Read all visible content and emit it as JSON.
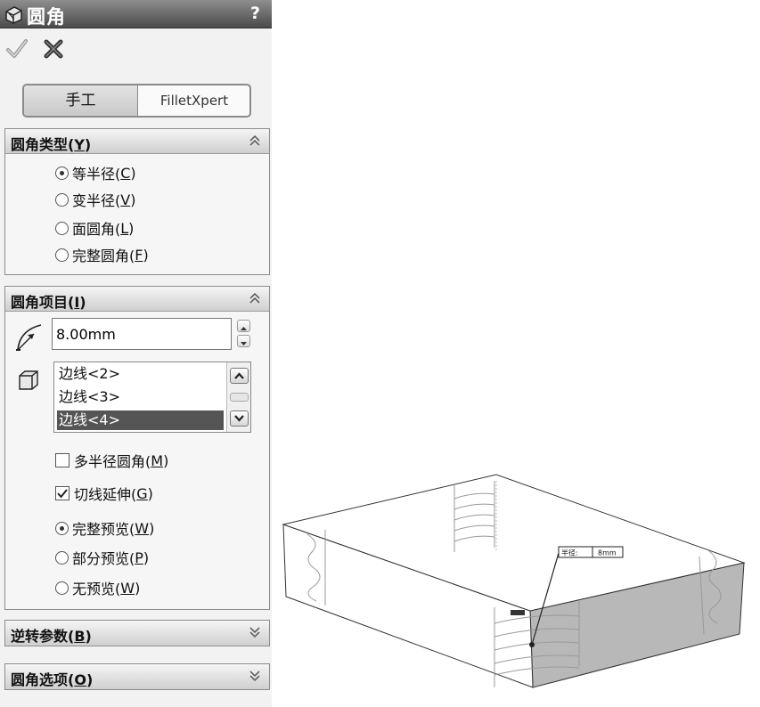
{
  "titlebar": {
    "title": "圆角",
    "help": "?"
  },
  "toolbar": {
    "ok_icon": "checkmark-icon",
    "cancel_icon": "x-icon"
  },
  "mode_tabs": {
    "manual": "手工",
    "filletxpert": "FilletXpert"
  },
  "fillet_type": {
    "header": "圆角类型(Y)",
    "header_text": "圆角类型(",
    "header_key": "Y",
    "header_close": ")",
    "options": [
      {
        "text": "等半径(",
        "key": "C",
        "close": ")",
        "selected": true
      },
      {
        "text": "变半径(",
        "key": "V",
        "close": ")",
        "selected": false
      },
      {
        "text": "面圆角(",
        "key": "L",
        "close": ")",
        "selected": false
      },
      {
        "text": "完整圆角(",
        "key": "F",
        "close": ")",
        "selected": false
      }
    ]
  },
  "fillet_items": {
    "header_text": "圆角项目(",
    "header_key": "I",
    "header_close": ")",
    "radius_value": "8.00mm",
    "edges": [
      "边线<2>",
      "边线<3>",
      "边线<4>"
    ],
    "selected_edge": "边线<4>",
    "multi_radius": {
      "text": "多半径圆角(",
      "key": "M",
      "close": ")",
      "checked": false
    },
    "tangent_propagation": {
      "text": "切线延伸(",
      "key": "G",
      "close": ")",
      "checked": true
    },
    "preview_options": [
      {
        "text": "完整预览(",
        "key": "W",
        "close": ")",
        "selected": true
      },
      {
        "text": "部分预览(",
        "key": "P",
        "close": ")",
        "selected": false
      },
      {
        "text": "无预览(",
        "key": "W",
        "close": ")",
        "selected": false
      }
    ]
  },
  "setback": {
    "header_text": "逆转参数(",
    "header_key": "B",
    "header_close": ")"
  },
  "fillet_options": {
    "header_text": "圆角选项(",
    "header_key": "O",
    "header_close": ")"
  },
  "model_callout": {
    "label": "半径:",
    "value": "8mm"
  }
}
